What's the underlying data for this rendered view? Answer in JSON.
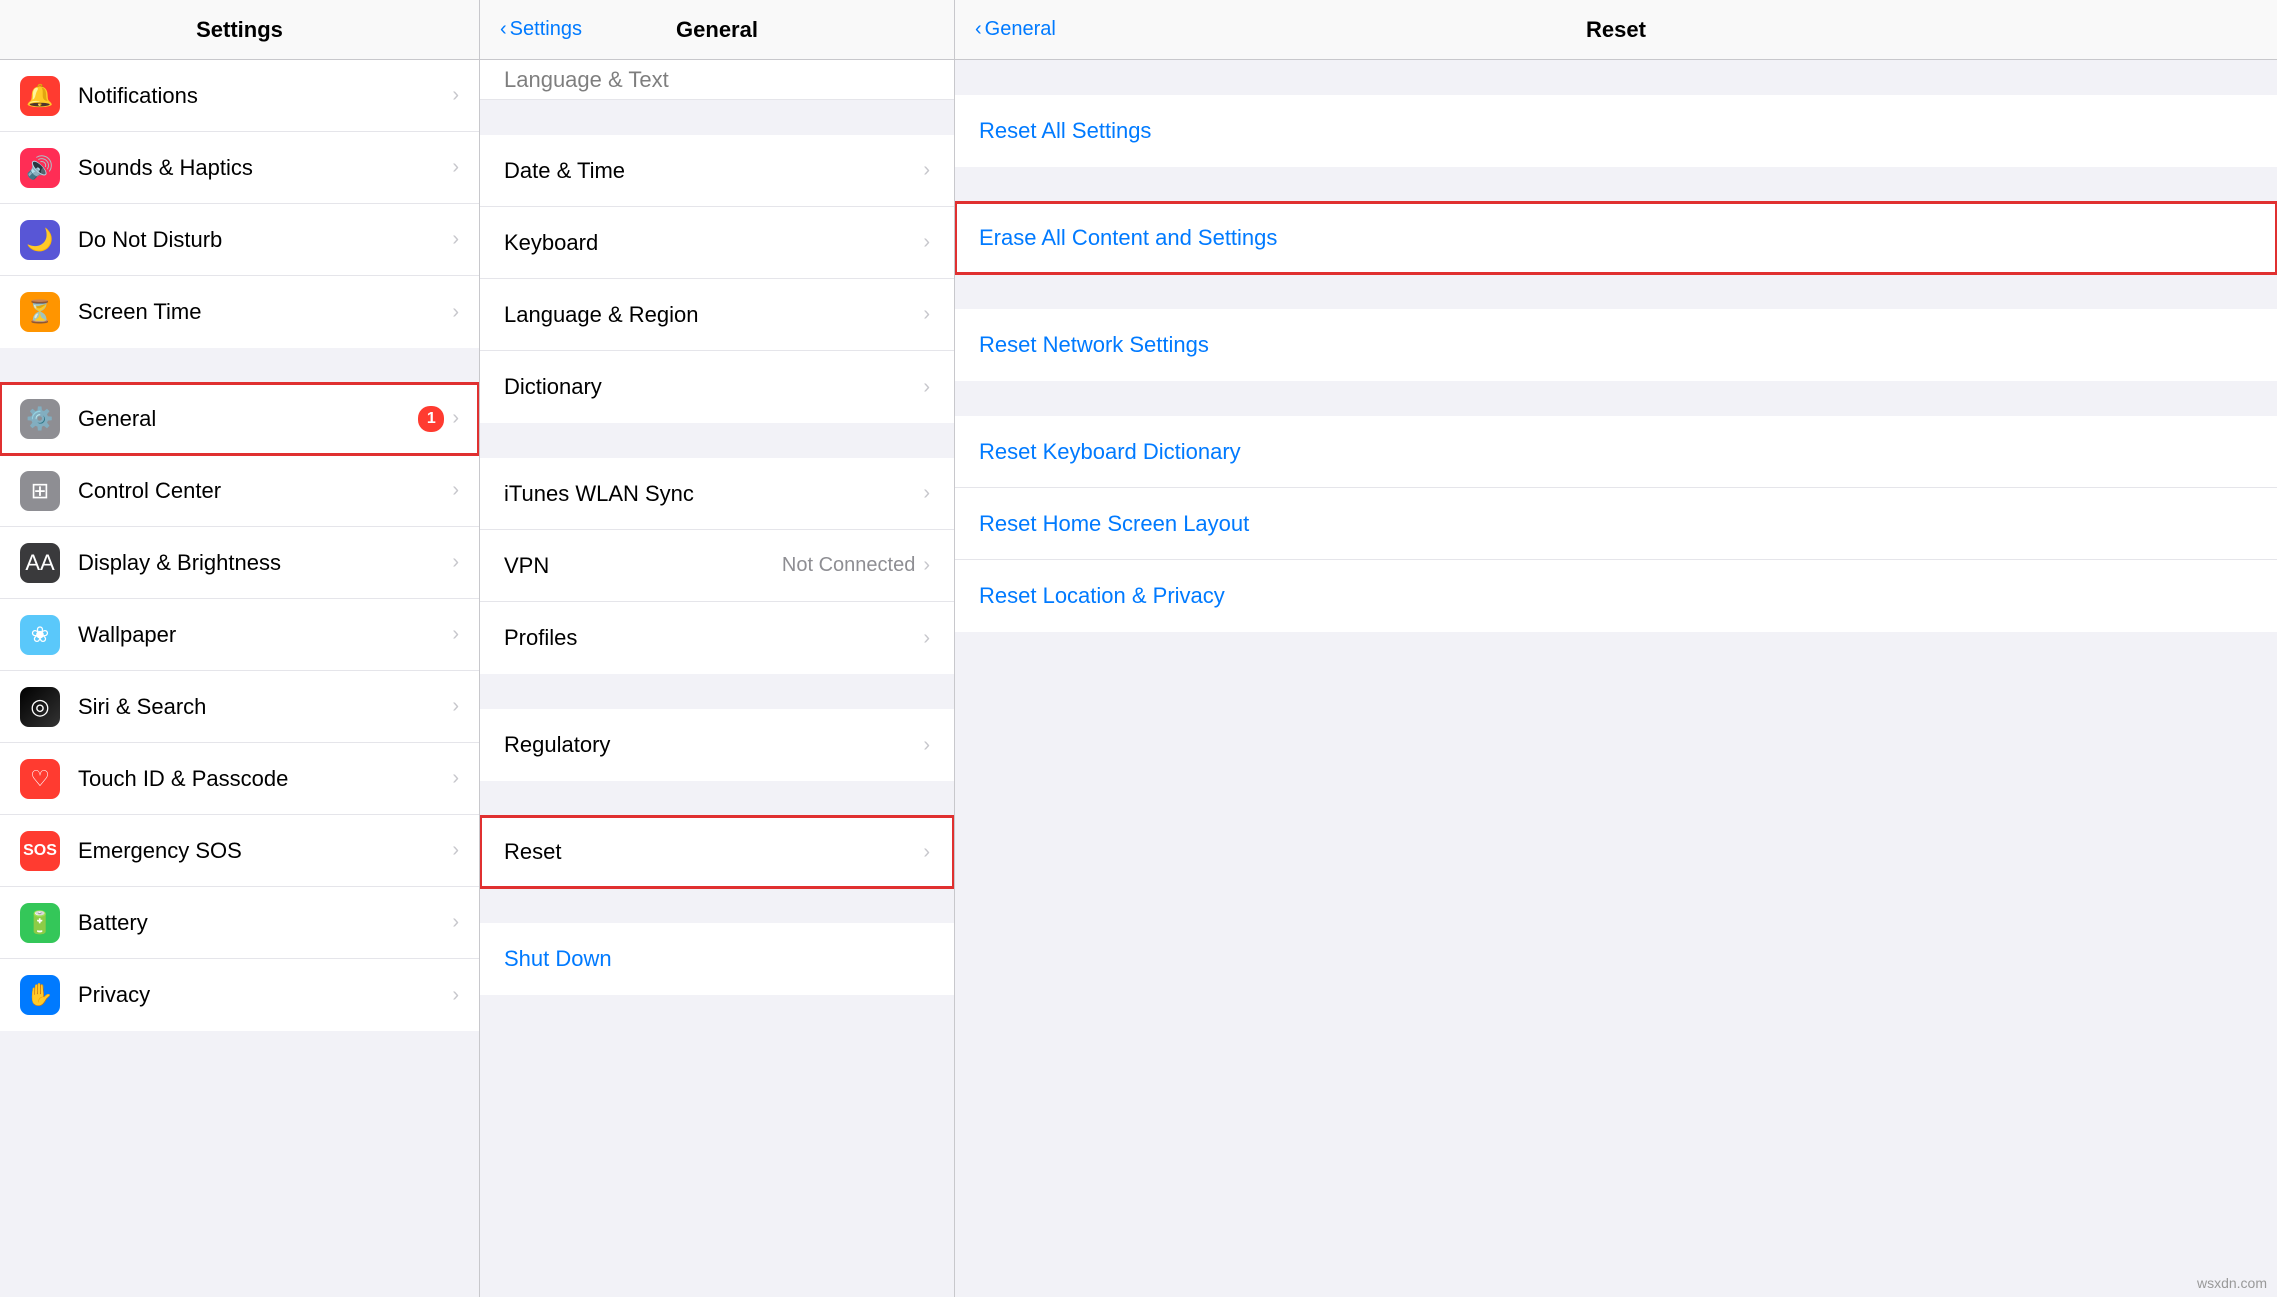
{
  "left_column": {
    "title": "Settings",
    "items": [
      {
        "id": "notifications",
        "label": "Notifications",
        "icon": "🔔",
        "icon_bg": "icon-red",
        "badge": null,
        "highlighted": false
      },
      {
        "id": "sounds",
        "label": "Sounds & Haptics",
        "icon": "🔊",
        "icon_bg": "icon-pink",
        "badge": null,
        "highlighted": false
      },
      {
        "id": "do-not-disturb",
        "label": "Do Not Disturb",
        "icon": "🌙",
        "icon_bg": "icon-purple",
        "badge": null,
        "highlighted": false
      },
      {
        "id": "screen-time",
        "label": "Screen Time",
        "icon": "⏳",
        "icon_bg": "icon-orange",
        "badge": null,
        "highlighted": false
      },
      {
        "id": "general",
        "label": "General",
        "icon": "⚙️",
        "icon_bg": "icon-gray",
        "badge": "1",
        "highlighted": true
      },
      {
        "id": "control-center",
        "label": "Control Center",
        "icon": "⊞",
        "icon_bg": "icon-gray",
        "badge": null,
        "highlighted": false
      },
      {
        "id": "display-brightness",
        "label": "Display & Brightness",
        "icon": "AA",
        "icon_bg": "icon-dark",
        "badge": null,
        "highlighted": false
      },
      {
        "id": "wallpaper",
        "label": "Wallpaper",
        "icon": "❀",
        "icon_bg": "icon-teal",
        "badge": null,
        "highlighted": false
      },
      {
        "id": "siri-search",
        "label": "Siri & Search",
        "icon": "◎",
        "icon_bg": "icon-siri",
        "badge": null,
        "highlighted": false
      },
      {
        "id": "touch-id",
        "label": "Touch ID & Passcode",
        "icon": "♡",
        "icon_bg": "icon-fingerprint",
        "badge": null,
        "highlighted": false
      },
      {
        "id": "emergency-sos",
        "label": "Emergency SOS",
        "icon": "SOS",
        "icon_bg": "icon-sos",
        "badge": null,
        "highlighted": false
      },
      {
        "id": "battery",
        "label": "Battery",
        "icon": "🔋",
        "icon_bg": "icon-green",
        "badge": null,
        "highlighted": false
      },
      {
        "id": "privacy",
        "label": "Privacy",
        "icon": "✋",
        "icon_bg": "icon-blue",
        "badge": null,
        "highlighted": false
      }
    ]
  },
  "middle_column": {
    "back_label": "Settings",
    "title": "General",
    "partial_text": "Language & Text",
    "groups": [
      {
        "items": [
          {
            "id": "date-time",
            "label": "Date & Time",
            "value": "",
            "highlighted": false
          },
          {
            "id": "keyboard",
            "label": "Keyboard",
            "value": "",
            "highlighted": false
          },
          {
            "id": "language-region",
            "label": "Language & Region",
            "value": "",
            "highlighted": false
          },
          {
            "id": "dictionary",
            "label": "Dictionary",
            "value": "",
            "highlighted": false
          }
        ]
      },
      {
        "items": [
          {
            "id": "itunes-sync",
            "label": "iTunes WLAN Sync",
            "value": "",
            "highlighted": false
          },
          {
            "id": "vpn",
            "label": "VPN",
            "value": "Not Connected",
            "highlighted": false
          },
          {
            "id": "profiles",
            "label": "Profiles",
            "value": "",
            "highlighted": false
          }
        ]
      },
      {
        "items": [
          {
            "id": "regulatory",
            "label": "Regulatory",
            "value": "",
            "highlighted": false
          }
        ]
      },
      {
        "items": [
          {
            "id": "reset",
            "label": "Reset",
            "value": "",
            "highlighted": true
          }
        ]
      }
    ],
    "shut_down_label": "Shut Down"
  },
  "right_column": {
    "back_label": "General",
    "title": "Reset",
    "groups": [
      {
        "items": [
          {
            "id": "reset-all-settings",
            "label": "Reset All Settings",
            "highlighted": false
          }
        ]
      },
      {
        "items": [
          {
            "id": "erase-all",
            "label": "Erase All Content and Settings",
            "highlighted": true
          }
        ]
      },
      {
        "items": [
          {
            "id": "reset-network",
            "label": "Reset Network Settings",
            "highlighted": false
          }
        ]
      },
      {
        "items": [
          {
            "id": "reset-keyboard",
            "label": "Reset Keyboard Dictionary",
            "highlighted": false
          },
          {
            "id": "reset-home-screen",
            "label": "Reset Home Screen Layout",
            "highlighted": false
          },
          {
            "id": "reset-location-privacy",
            "label": "Reset Location & Privacy",
            "highlighted": false
          }
        ]
      }
    ]
  },
  "watermark": "wsxdn.com"
}
